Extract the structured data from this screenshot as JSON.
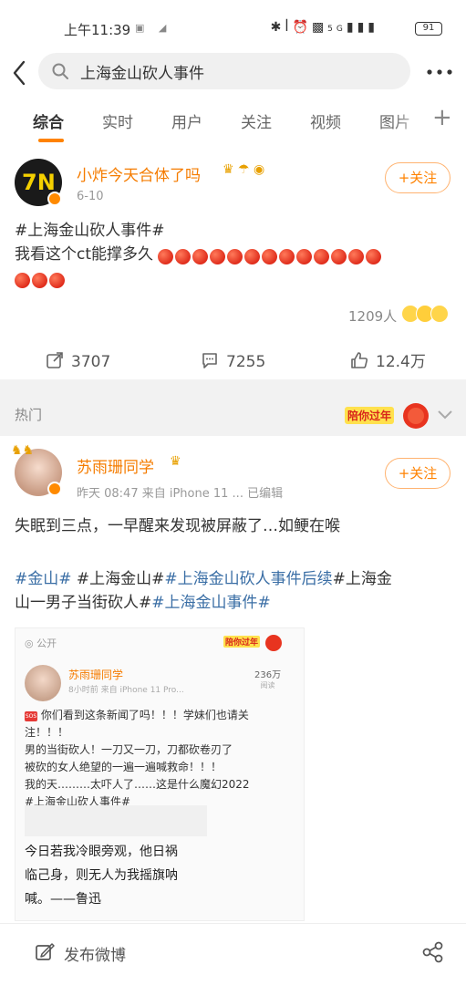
{
  "status_bar": {
    "time": "上午11:39",
    "signal_text": "5G",
    "battery": "91"
  },
  "search": {
    "query": "上海金山砍人事件"
  },
  "tabs": [
    {
      "label": "综合"
    },
    {
      "label": "实时"
    },
    {
      "label": "用户"
    },
    {
      "label": "关注"
    },
    {
      "label": "视频"
    },
    {
      "label": "图片"
    }
  ],
  "post1": {
    "author": "小炸今天合体了吗",
    "avatar_text": "7N",
    "date": "6-10",
    "follow_label": "+关注",
    "topic": "#上海金山砍人事件#",
    "text": "我看这个ct能撑多久",
    "likers_count": "1209人",
    "reposts": "3707",
    "comments": "7255",
    "likes": "12.4万"
  },
  "hot_section": {
    "label": "热门",
    "banner": "陪你过年"
  },
  "post2": {
    "author": "苏雨珊同学",
    "meta": "昨天 08:47  来自 iPhone 11 ...  已编辑",
    "follow_label": "+关注",
    "text": "失眠到三点，一早醒来发现被屏蔽了…如鲠在喉",
    "topics_line1_a": "#金山#",
    "topics_line1_b": " #上海金山#",
    "topics_line1_c": "#上海金山砍人事件后续",
    "topics_line1_d": "#上海金",
    "topics_line2_a": "山一男子当街砍人#",
    "topics_line2_b": "#上海金山事件#",
    "embed": {
      "public_label": "公开",
      "banner": "陪你过年",
      "name": "苏雨珊同学",
      "meta": "8小时前  来自 iPhone 11 Pro...",
      "count": "236万",
      "count_label": "阅读",
      "line1": "你们看到这条新闻了吗！！！学妹们也请关",
      "line2": "注！！！",
      "line3": "男的当街砍人！一刀又一刀，刀都砍卷刃了",
      "line4": "被砍的女人绝望的一遍一遍喊救命！！！",
      "line5": "我的天………太吓人了……这是什么魔幻2022",
      "line6": "#上海金山砍人事件#",
      "quote1": "今日若我冷眼旁观，他日祸",
      "quote2": "临己身，则无人为我摇旗呐",
      "quote3": "喊。——鲁迅"
    }
  },
  "compose": {
    "label": "发布微博"
  },
  "colors": {
    "accent": "#ff8200",
    "topic": "#3a6ea5",
    "username": "#f57c00"
  }
}
